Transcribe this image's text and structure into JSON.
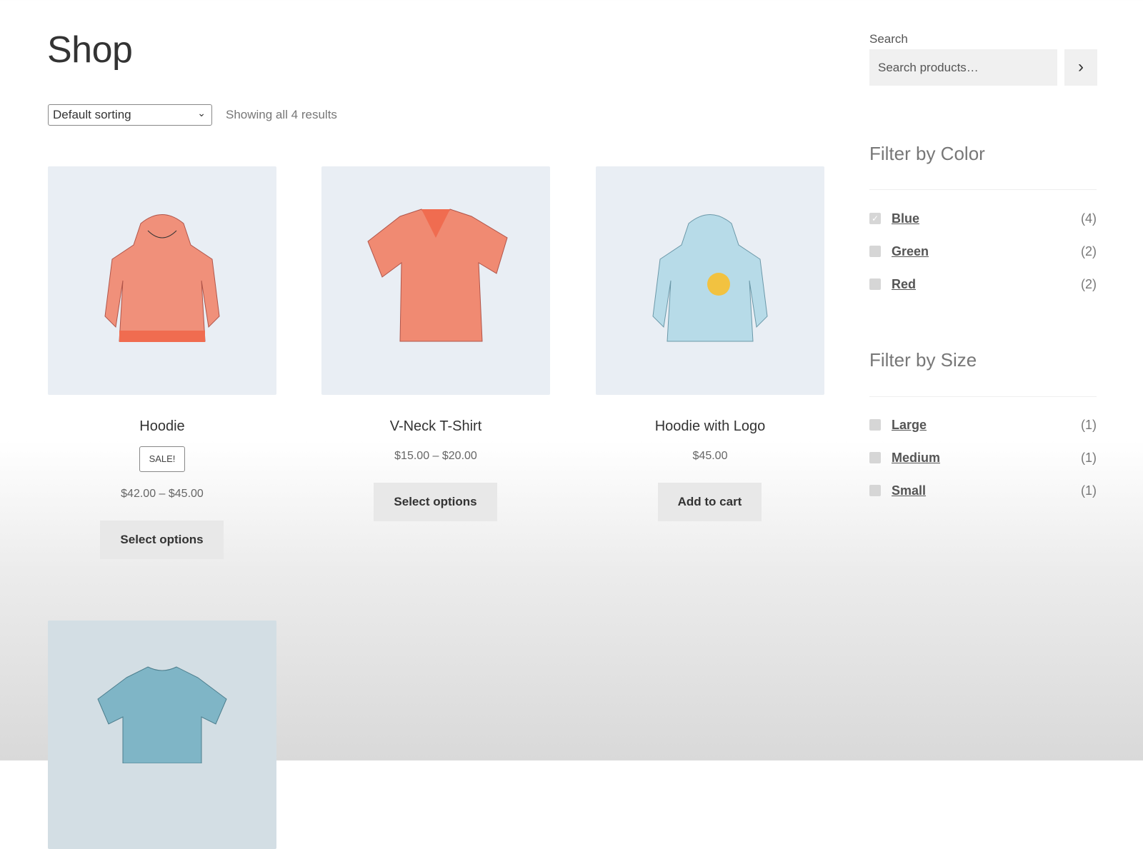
{
  "page": {
    "title": "Shop"
  },
  "toolbar": {
    "sort_value": "Default sorting",
    "result_count": "Showing all 4 results"
  },
  "products": [
    {
      "name": "Hoodie",
      "badge": "SALE!",
      "price": "$42.00 – $45.00",
      "button": "Select options",
      "color": "#f0907a"
    },
    {
      "name": "V-Neck T-Shirt",
      "price": "$15.00 – $20.00",
      "button": "Select options",
      "color": "#f08a72"
    },
    {
      "name": "Hoodie with Logo",
      "price": "$45.00",
      "button": "Add to cart",
      "color": "#b7dbe8"
    },
    {
      "color": "#7fb5c6"
    }
  ],
  "sidebar": {
    "search": {
      "label": "Search",
      "placeholder": "Search products…",
      "submit_icon": "chevron-right-icon"
    },
    "color_filter": {
      "title": "Filter by Color",
      "items": [
        {
          "label": "Blue",
          "count": "(4)",
          "checked": true
        },
        {
          "label": "Green",
          "count": "(2)",
          "checked": false
        },
        {
          "label": "Red",
          "count": "(2)",
          "checked": false
        }
      ]
    },
    "size_filter": {
      "title": "Filter by Size",
      "items": [
        {
          "label": "Large",
          "count": "(1)",
          "checked": false
        },
        {
          "label": "Medium",
          "count": "(1)",
          "checked": false
        },
        {
          "label": "Small",
          "count": "(1)",
          "checked": false
        }
      ]
    }
  }
}
